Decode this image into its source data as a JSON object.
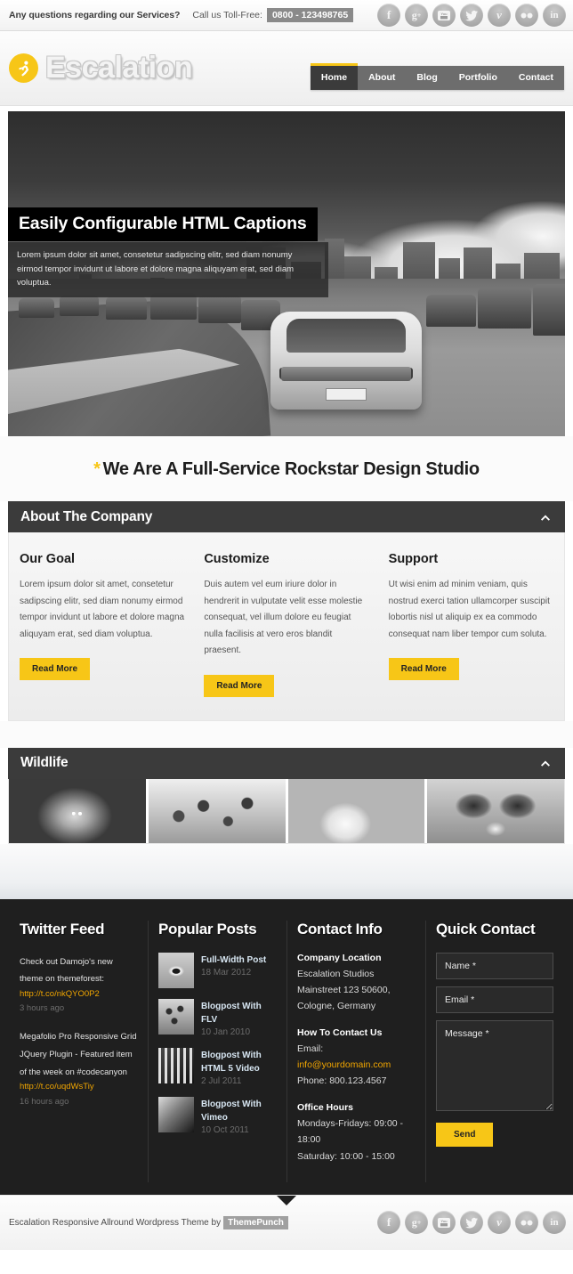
{
  "topbar": {
    "question": "Any questions regarding our Services?",
    "call_label": "Call us Toll-Free:",
    "phone": "0800 - 123498765",
    "social": [
      {
        "name": "facebook-icon",
        "glyph": "f"
      },
      {
        "name": "googleplus-icon",
        "glyph": "g+"
      },
      {
        "name": "youtube-icon",
        "glyph": "You"
      },
      {
        "name": "twitter-icon",
        "glyph": "t"
      },
      {
        "name": "vimeo-icon",
        "glyph": "v"
      },
      {
        "name": "flickr-icon",
        "glyph": "••"
      },
      {
        "name": "linkedin-icon",
        "glyph": "in"
      }
    ]
  },
  "header": {
    "logo_text": "Escalation",
    "logo_icon": "running-person-icon",
    "accent_color": "#f7c617",
    "nav": [
      {
        "label": "Home",
        "active": true
      },
      {
        "label": "About",
        "active": false
      },
      {
        "label": "Blog",
        "active": false
      },
      {
        "label": "Portfolio",
        "active": false
      },
      {
        "label": "Contact",
        "active": false
      }
    ]
  },
  "hero": {
    "caption_title": "Easily Configurable HTML Captions",
    "caption_text": "Lorem ipsum dolor sit amet, consetetur sadipscing elitr, sed diam nonumy eirmod tempor invidunt ut labore et dolore magna aliquyam erat, sed diam voluptua.",
    "image_alt": "grayscale city skyline with clouds above a congested freeway"
  },
  "tagline": {
    "star": "*",
    "text": "We Are A Full-Service Rockstar Design Studio"
  },
  "about": {
    "heading": "About The Company",
    "toggle_icon": "chevron-up-icon",
    "columns": [
      {
        "title": "Our Goal",
        "body": "Lorem ipsum dolor sit amet, consetetur sadipscing elitr, sed diam nonumy eirmod tempor invidunt ut labore et dolore magna aliquyam erat, sed diam voluptua.",
        "button": "Read More"
      },
      {
        "title": "Customize",
        "body": "Duis autem vel eum iriure dolor in hendrerit in vulputate velit esse molestie consequat, vel illum dolore eu feugiat nulla facilisis at vero eros blandit praesent.",
        "button": "Read More"
      },
      {
        "title": "Support",
        "body": "Ut wisi enim ad minim veniam, quis nostrud exerci tation ullamcorper suscipit lobortis nisl ut aliquip ex ea commodo consequat nam liber tempor cum soluta.",
        "button": "Read More"
      }
    ]
  },
  "wildlife": {
    "heading": "Wildlife",
    "toggle_icon": "chevron-up-icon",
    "thumbs": [
      {
        "name": "wildlife-thumb-lion",
        "alt": "lion"
      },
      {
        "name": "wildlife-thumb-giraffe",
        "alt": "giraffe"
      },
      {
        "name": "wildlife-thumb-egret",
        "alt": "white egret"
      },
      {
        "name": "wildlife-thumb-butterfly",
        "alt": "butterfly"
      }
    ]
  },
  "footer": {
    "twitter": {
      "heading": "Twitter Feed",
      "tweets": [
        {
          "text": "Check out Damojo's new theme on themeforest:",
          "link": "http://t.co/nkQYO0P2",
          "time": "3 hours ago"
        },
        {
          "text": "Megafolio Pro Responsive Grid JQuery Plugin - Featured item of the week on #codecanyon",
          "link": "http://t.co/uqdWsTiy",
          "time": "16 hours ago"
        }
      ]
    },
    "popular": {
      "heading": "Popular Posts",
      "posts": [
        {
          "title": "Full-Width Post",
          "date": "18 Mar 2012",
          "thumb": "eye-photo-thumb"
        },
        {
          "title": "Blogpost With FLV",
          "date": "10 Jan 2010",
          "thumb": "leopard-photo-thumb"
        },
        {
          "title": "Blogpost With HTML 5 Video",
          "date": "2 Jul 2011",
          "thumb": "film-photo-thumb"
        },
        {
          "title": "Blogpost With Vimeo",
          "date": "10 Oct 2011",
          "thumb": "abstract-photo-thumb"
        }
      ]
    },
    "contact": {
      "heading": "Contact Info",
      "location_label": "Company Location",
      "location_lines": [
        "Escalation Studios",
        "Mainstreet 123 50600,",
        "Cologne, Germany"
      ],
      "how_label": "How To Contact Us",
      "email_label": "Email:",
      "email": "info@yourdomain.com",
      "phone": "Phone: 800.123.4567",
      "hours_label": "Office Hours",
      "hours_lines": [
        "Mondays-Fridays: 09:00 - 18:00",
        "Saturday: 10:00 - 15:00"
      ]
    },
    "quick": {
      "heading": "Quick Contact",
      "name_placeholder": "Name *",
      "email_placeholder": "Email *",
      "message_placeholder": "Message *",
      "send_label": "Send"
    }
  },
  "bottombar": {
    "text": "Escalation Responsive Allround Wordpress Theme by",
    "brand": "ThemePunch",
    "social": [
      {
        "name": "facebook-icon",
        "glyph": "f"
      },
      {
        "name": "googleplus-icon",
        "glyph": "g+"
      },
      {
        "name": "youtube-icon",
        "glyph": "You"
      },
      {
        "name": "twitter-icon",
        "glyph": "t"
      },
      {
        "name": "vimeo-icon",
        "glyph": "v"
      },
      {
        "name": "flickr-icon",
        "glyph": "••"
      },
      {
        "name": "linkedin-icon",
        "glyph": "in"
      }
    ]
  }
}
